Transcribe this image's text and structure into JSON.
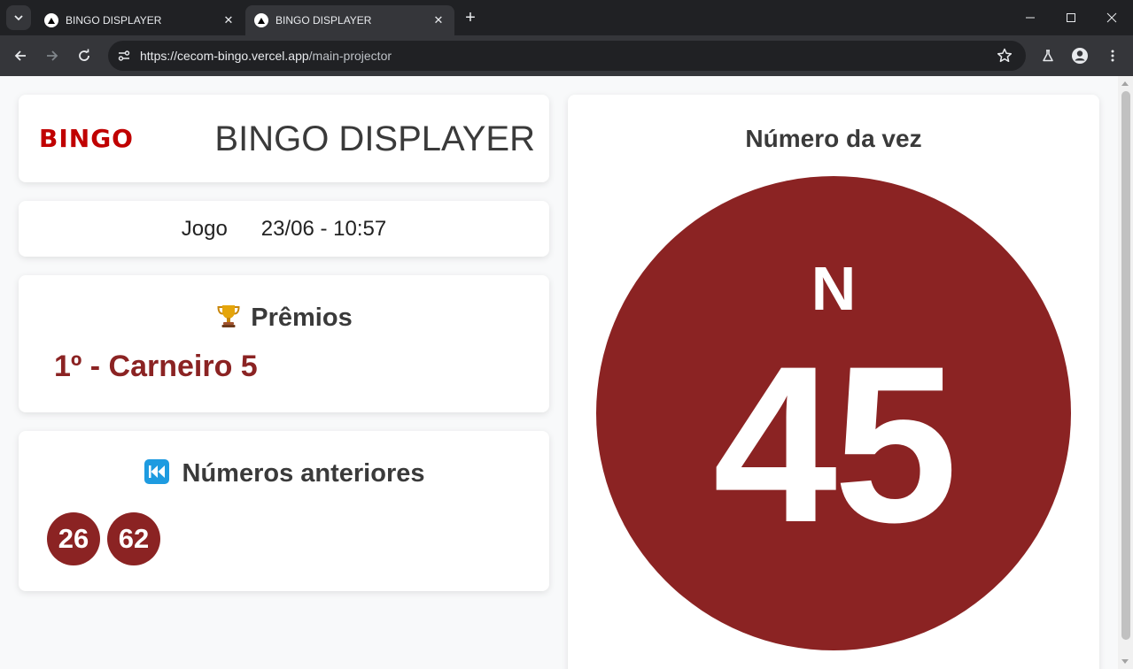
{
  "browser": {
    "tabs": [
      {
        "title": "BINGO DISPLAYER",
        "active": false
      },
      {
        "title": "BINGO DISPLAYER",
        "active": true
      }
    ],
    "url_host": "https://cecom-bingo.vercel.app",
    "url_path": "/main-projector",
    "tab_close_glyph": "✕",
    "new_tab_glyph": "+"
  },
  "header": {
    "logo_text": "BINGO",
    "title": "BINGO DISPLAYER"
  },
  "game": {
    "label": "Jogo",
    "datetime": "23/06 - 10:57"
  },
  "prizes": {
    "icon": "trophy-icon",
    "title": "Prêmios",
    "items": [
      "1º - Carneiro 5"
    ]
  },
  "previous": {
    "icon": "rewind-icon",
    "title": "Números anteriores",
    "numbers": [
      "26",
      "62"
    ]
  },
  "current": {
    "title": "Número da vez",
    "letter": "N",
    "number": "45"
  },
  "colors": {
    "accent": "#8b2323",
    "logo": "#c00000",
    "page_bg": "#f8f9fa",
    "chrome_dark": "#202124"
  }
}
